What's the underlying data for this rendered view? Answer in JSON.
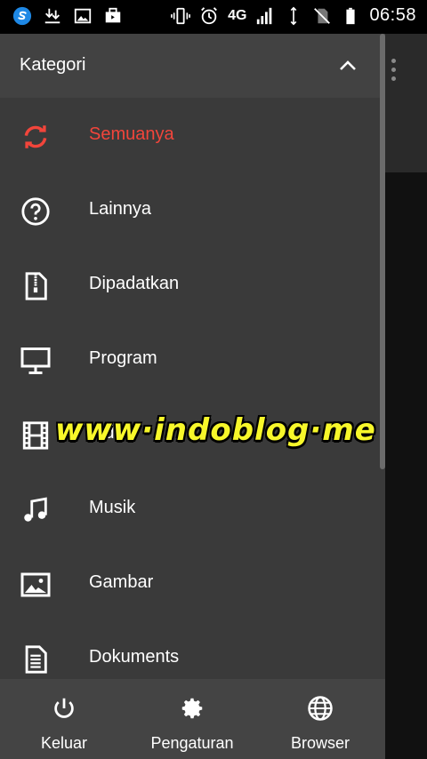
{
  "status_bar": {
    "network": "4G",
    "time": "06:58"
  },
  "drawer": {
    "title": "Kategori",
    "items": [
      {
        "label": "Semuanya",
        "icon": "refresh-icon",
        "active": true
      },
      {
        "label": "Lainnya",
        "icon": "help-circle-icon",
        "active": false
      },
      {
        "label": "Dipadatkan",
        "icon": "zip-file-icon",
        "active": false
      },
      {
        "label": "Program",
        "icon": "monitor-icon",
        "active": false
      },
      {
        "label": "Video",
        "icon": "film-icon",
        "active": false
      },
      {
        "label": "Musik",
        "icon": "music-note-icon",
        "active": false
      },
      {
        "label": "Gambar",
        "icon": "image-icon",
        "active": false
      },
      {
        "label": "Dokuments",
        "icon": "document-icon",
        "active": false
      }
    ],
    "bottom": [
      {
        "label": "Keluar",
        "icon": "power-icon"
      },
      {
        "label": "Pengaturan",
        "icon": "gear-icon"
      },
      {
        "label": "Browser",
        "icon": "globe-icon"
      }
    ]
  },
  "watermark": "www·indoblog·me",
  "colors": {
    "active": "#f2453b",
    "drawer_bg": "#3a3a3a",
    "watermark": "#f7f72a"
  }
}
